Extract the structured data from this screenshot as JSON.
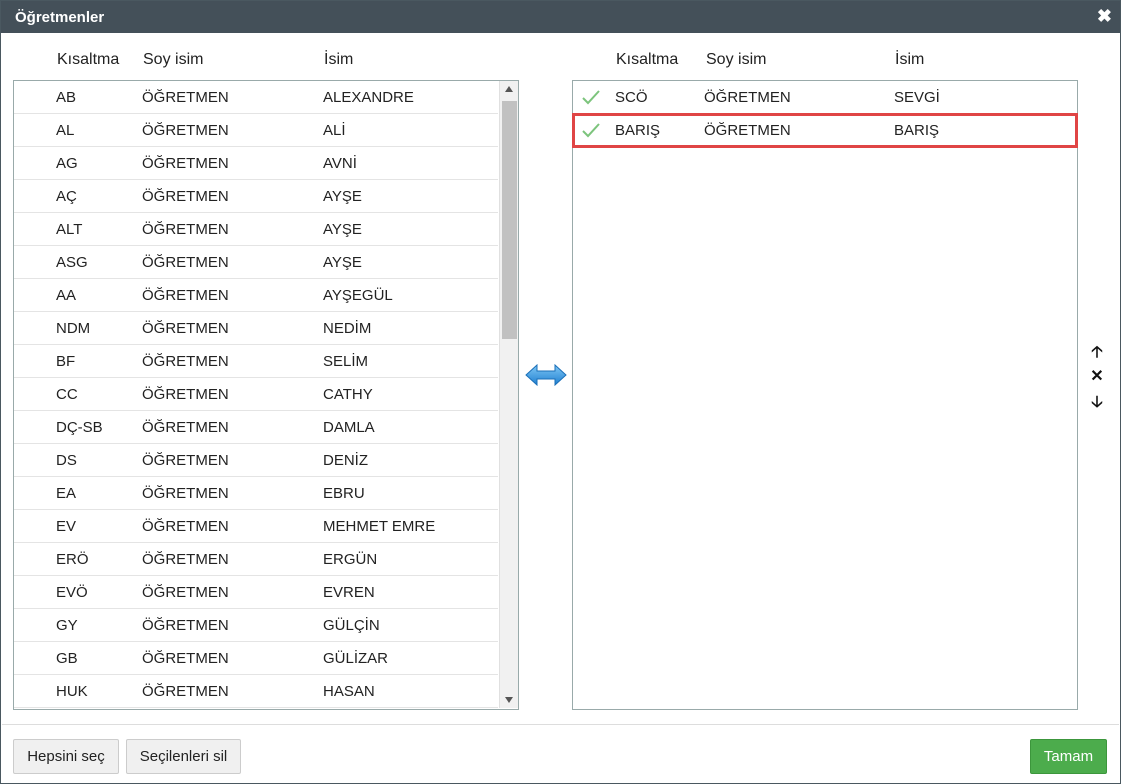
{
  "window": {
    "title": "Öğretmenler",
    "close_glyph": "✖"
  },
  "left_table": {
    "headers": [
      "Kısaltma",
      "Soy isim",
      "İsim"
    ],
    "rows": [
      [
        "AB",
        "ÖĞRETMEN",
        "ALEXANDRE"
      ],
      [
        "AL",
        "ÖĞRETMEN",
        "ALİ"
      ],
      [
        "AG",
        "ÖĞRETMEN",
        "AVNİ"
      ],
      [
        "AÇ",
        "ÖĞRETMEN",
        "AYŞE"
      ],
      [
        "ALT",
        "ÖĞRETMEN",
        "AYŞE"
      ],
      [
        "ASG",
        "ÖĞRETMEN",
        "AYŞE"
      ],
      [
        "AA",
        "ÖĞRETMEN",
        "AYŞEGÜL"
      ],
      [
        "NDM",
        "ÖĞRETMEN",
        "NEDİM"
      ],
      [
        "BF",
        "ÖĞRETMEN",
        "SELİM"
      ],
      [
        "CC",
        "ÖĞRETMEN",
        "CATHY"
      ],
      [
        "DÇ-SB",
        "ÖĞRETMEN",
        "DAMLA"
      ],
      [
        "DS",
        "ÖĞRETMEN",
        "DENİZ"
      ],
      [
        "EA",
        "ÖĞRETMEN",
        "EBRU"
      ],
      [
        "EV",
        "ÖĞRETMEN",
        "MEHMET EMRE"
      ],
      [
        "ERÖ",
        "ÖĞRETMEN",
        "ERGÜN"
      ],
      [
        "EVÖ",
        "ÖĞRETMEN",
        "EVREN"
      ],
      [
        "GY",
        "ÖĞRETMEN",
        "GÜLÇİN"
      ],
      [
        "GB",
        "ÖĞRETMEN",
        "GÜLİZAR"
      ],
      [
        "HUK",
        "ÖĞRETMEN",
        "HASAN"
      ]
    ]
  },
  "right_table": {
    "headers": [
      "Kısaltma",
      "Soy isim",
      "İsim"
    ],
    "rows": [
      [
        "SCÖ",
        "ÖĞRETMEN",
        "SEVGİ"
      ],
      [
        "BARIŞ",
        "ÖĞRETMEN",
        "BARIŞ"
      ]
    ],
    "selected_row": 1
  },
  "side_controls": {
    "up": "🡡",
    "remove": "✕",
    "down": "🡣"
  },
  "icons": {
    "transfer": "transfer-arrows-icon",
    "check": "check-icon"
  },
  "colors": {
    "title_bar": "#445059",
    "check": "#7cc47c",
    "selection": "#e04545",
    "ok_button": "#4cac4c"
  },
  "footer": {
    "select_all": "Hepsini seç",
    "delete_selected": "Seçilenleri sil",
    "ok": "Tamam"
  }
}
